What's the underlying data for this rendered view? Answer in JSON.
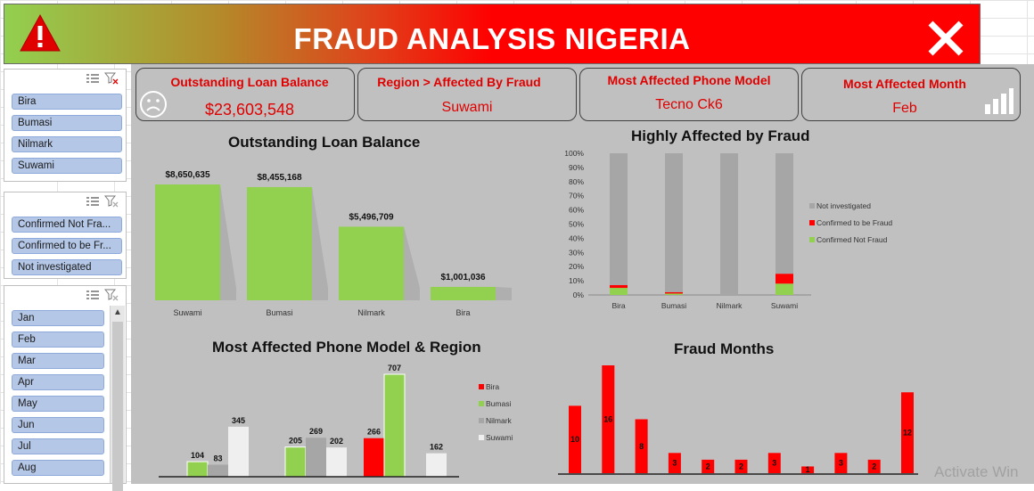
{
  "banner": {
    "title": "FRAUD ANALYSIS NIGERIA",
    "icons": [
      "warning-triangle-icon",
      "close-x-icon"
    ]
  },
  "slicers": {
    "region": {
      "items": [
        "Bira",
        "Bumasi",
        "Nilmark",
        "Suwami"
      ]
    },
    "status": {
      "items": [
        "Confirmed Not Fra...",
        "Confirmed to be Fr...",
        "Not investigated"
      ]
    },
    "month": {
      "items": [
        "Jan",
        "Feb",
        "Mar",
        "Apr",
        "May",
        "Jun",
        "Jul",
        "Aug"
      ]
    }
  },
  "kpis": {
    "loan": {
      "title": "Outstanding Loan Balance",
      "value": "$23,603,548",
      "icon": "sad-face-icon"
    },
    "region": {
      "title": "Region > Affected By Fraud",
      "value": "Suwami"
    },
    "phone": {
      "title": "Most Affected Phone Model",
      "value": "Tecno Ck6"
    },
    "month": {
      "title": "Most Affected Month",
      "value": "Feb",
      "icon": "bar-chart-icon"
    }
  },
  "colors": {
    "green": "#92d050",
    "red": "#ff0000",
    "gray": "#a6a6a6",
    "light": "#efefef",
    "bg": "#c0c0c0"
  },
  "chart_data": [
    {
      "id": "loan",
      "type": "bar",
      "title": "Outstanding Loan Balance",
      "categories": [
        "Suwami",
        "Bumasi",
        "Nilmark",
        "Bira"
      ],
      "values": [
        8650635,
        8455168,
        5496709,
        1001036
      ],
      "labels": [
        "$8,650,635",
        "$8,455,168",
        "$5,496,709",
        "$1,001,036"
      ]
    },
    {
      "id": "fraud",
      "type": "bar",
      "title": "Highly Affected by Fraud",
      "stacked": "100%",
      "categories": [
        "Bira",
        "Bumasi",
        "Nilmark",
        "Suwami"
      ],
      "yticks": [
        "0%",
        "10%",
        "20%",
        "30%",
        "40%",
        "50%",
        "60%",
        "70%",
        "80%",
        "90%",
        "100%"
      ],
      "legend_position": "right",
      "series": [
        {
          "name": "Confirmed Not Fraud",
          "values": [
            5,
            1,
            0,
            8
          ]
        },
        {
          "name": "Confirmed to be Fraud",
          "values": [
            2,
            1,
            0,
            7
          ]
        },
        {
          "name": "Not investigated",
          "values": [
            93,
            98,
            100,
            85
          ]
        }
      ]
    },
    {
      "id": "phone",
      "type": "bar",
      "title": "Most Affected Phone Model & Region",
      "legend_position": "right",
      "series": [
        {
          "name": "Bira",
          "values": [
            null,
            null,
            266,
            null
          ]
        },
        {
          "name": "Bumasi",
          "values": [
            104,
            205,
            707,
            null
          ]
        },
        {
          "name": "Nilmark",
          "values": [
            83,
            269,
            null,
            null
          ]
        },
        {
          "name": "Suwami",
          "values": [
            345,
            202,
            null,
            162
          ]
        }
      ]
    },
    {
      "id": "months",
      "type": "bar",
      "title": "Fraud Months",
      "values": [
        10,
        16,
        8,
        3,
        2,
        2,
        3,
        1,
        3,
        2,
        12
      ]
    }
  ],
  "watermark": "Activate Win"
}
